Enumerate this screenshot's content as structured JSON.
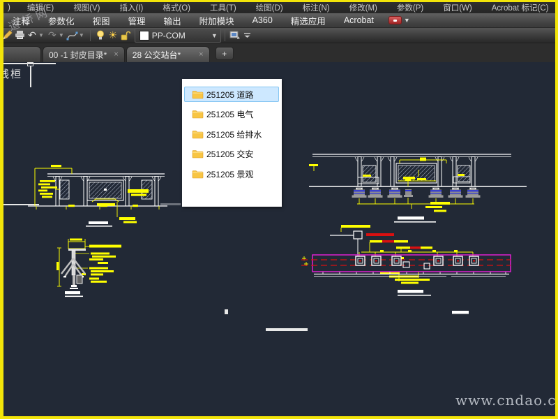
{
  "menu_bar": {
    "overflow_fragment": ")",
    "items": [
      "编辑(E)",
      "视图(V)",
      "插入(I)",
      "格式(O)",
      "工具(T)",
      "绘图(D)",
      "标注(N)",
      "修改(M)",
      "参数(P)",
      "窗口(W)",
      "Acrobat 标记(C)"
    ]
  },
  "ribbon_tabs": [
    "注释",
    "参数化",
    "视图",
    "管理",
    "输出",
    "附加模块",
    "A360",
    "精选应用",
    "Acrobat"
  ],
  "quick_toolbar": {
    "layer_selector_value": "PP-COM"
  },
  "document_tabs": {
    "tab1_label": "00 -1 封皮目录*",
    "tab2_label": "28 公交站台*",
    "close_glyph": "×",
    "new_tab_glyph": "+"
  },
  "folder_popup": {
    "selected_index": 0,
    "items": [
      "251205 道路",
      "251205 电气",
      "251205 给排水",
      "251205 交安",
      "251205 景观"
    ]
  },
  "canvas": {
    "clipped_label": "线桓"
  },
  "watermark": {
    "logo_text": "道桥网",
    "site_url": "www.cndao.com"
  },
  "colors": {
    "cad_yellow": "#ffff00",
    "cad_white": "#ffffff",
    "cad_magenta": "#e020d0",
    "cad_red": "#d81010",
    "selection_blue": "#cde8ff",
    "canvas_bg": "#222936",
    "frame_yellow": "#f2e409"
  }
}
